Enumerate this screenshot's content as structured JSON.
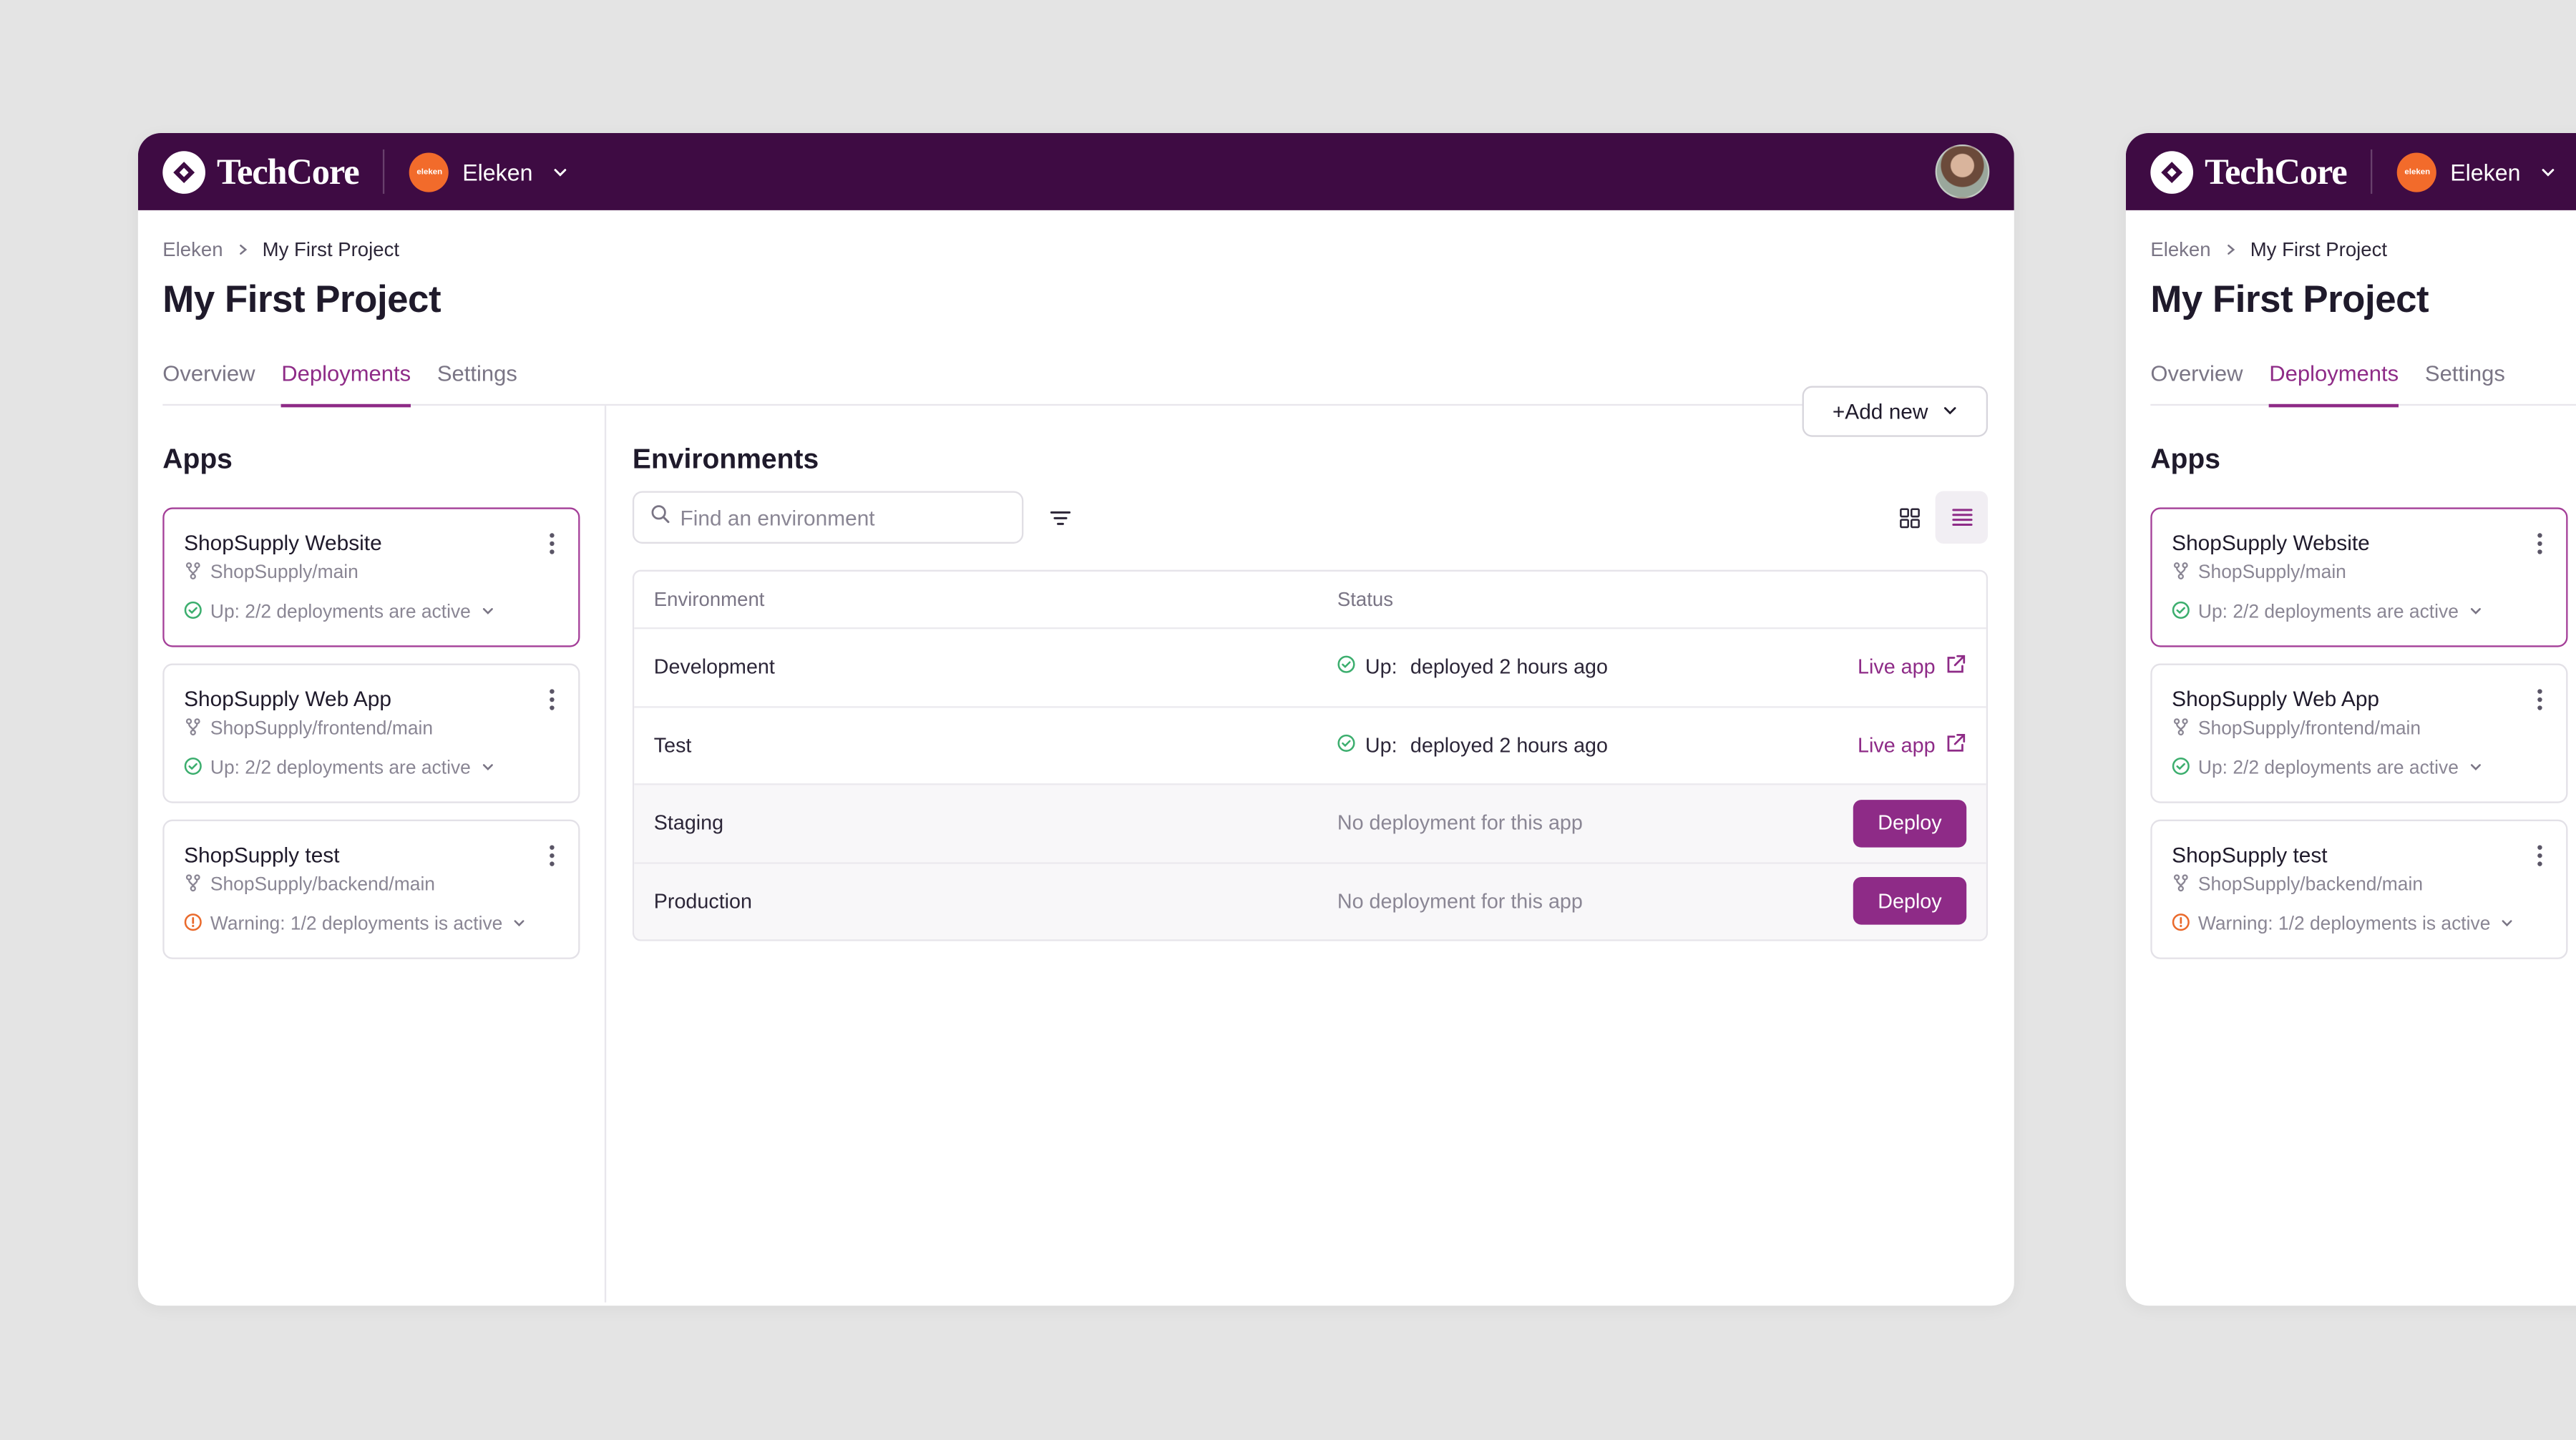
{
  "brand": {
    "name": "TechCore"
  },
  "org": {
    "name": "Eleken",
    "avatar_text": "eleken"
  },
  "breadcrumb": {
    "root": "Eleken",
    "current": "My First Project"
  },
  "page": {
    "title": "My First Project",
    "add_button": "+Add new"
  },
  "tabs": [
    {
      "label": "Overview"
    },
    {
      "label": "Deployments"
    },
    {
      "label": "Settings"
    }
  ],
  "apps": {
    "title": "Apps",
    "items": [
      {
        "name": "ShopSupply Website",
        "branch": "ShopSupply/main",
        "status": "Up: 2/2 deployments are active"
      },
      {
        "name": "ShopSupply Web App",
        "branch": "ShopSupply/frontend/main",
        "status": "Up: 2/2 deployments are active"
      },
      {
        "name": "ShopSupply test",
        "branch": "ShopSupply/backend/main",
        "status": "Warning: 1/2 deployments is active"
      }
    ]
  },
  "environments": {
    "title": "Environments",
    "search_placeholder": "Find an environment",
    "columns": {
      "environment": "Environment",
      "status": "Status"
    },
    "rows": [
      {
        "name": "Development",
        "status_prefix": "Up:",
        "status": "deployed 2 hours ago",
        "action": "Live app"
      },
      {
        "name": "Test",
        "status_prefix": "Up:",
        "status": "deployed 2 hours ago",
        "action": "Live app"
      },
      {
        "name": "Staging",
        "status": "No deployment for this app",
        "action": "Deploy"
      },
      {
        "name": "Production",
        "status": "No deployment for this app",
        "action": "Deploy"
      }
    ]
  },
  "colors": {
    "topbar": "#3e0b43",
    "accent": "#8e2b87",
    "org_avatar": "#f26b2b",
    "success": "#3cae6e",
    "warning": "#ea6a2c"
  }
}
